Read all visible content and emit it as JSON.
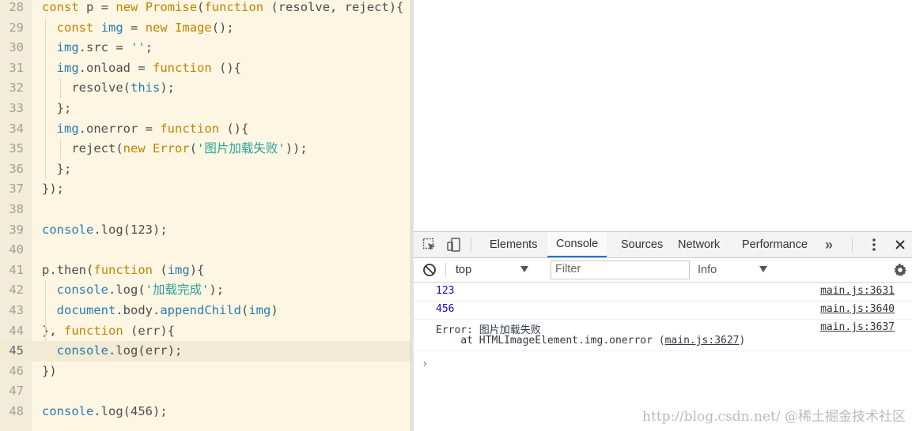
{
  "editor": {
    "active_line": "45",
    "lines": [
      {
        "n": "28",
        "text": "const p = new Promise(function (resolve, reject){"
      },
      {
        "n": "29",
        "text": "  const img = new Image();"
      },
      {
        "n": "30",
        "text": "  img.src = '';"
      },
      {
        "n": "31",
        "text": "  img.onload = function (){"
      },
      {
        "n": "32",
        "text": "    resolve(this);"
      },
      {
        "n": "33",
        "text": "  };"
      },
      {
        "n": "34",
        "text": "  img.onerror = function (){"
      },
      {
        "n": "35",
        "text": "    reject(new Error('图片加载失败'));"
      },
      {
        "n": "36",
        "text": "  };"
      },
      {
        "n": "37",
        "text": "});"
      },
      {
        "n": "38",
        "text": ""
      },
      {
        "n": "39",
        "text": "console.log(123);"
      },
      {
        "n": "40",
        "text": ""
      },
      {
        "n": "41",
        "text": "p.then(function (img){"
      },
      {
        "n": "42",
        "text": "  console.log('加载完成');"
      },
      {
        "n": "43",
        "text": "  document.body.appendChild(img)"
      },
      {
        "n": "44",
        "text": "}, function (err){"
      },
      {
        "n": "45",
        "text": "  console.log(err);"
      },
      {
        "n": "46",
        "text": "})"
      },
      {
        "n": "47",
        "text": ""
      },
      {
        "n": "48",
        "text": "console.log(456);"
      }
    ]
  },
  "devtools": {
    "tabs": [
      {
        "label": "Elements"
      },
      {
        "label": "Console",
        "selected": true
      },
      {
        "label": "Sources"
      },
      {
        "label": "Network"
      },
      {
        "label": "Performance"
      }
    ],
    "more_tabs_glyph": "»",
    "icons": {
      "inspect": "inspect-element-icon",
      "device": "device-toolbar-icon",
      "more": "kebab-menu-icon",
      "close": "close-icon",
      "clear": "clear-console-icon",
      "settings": "gear-icon"
    },
    "console_toolbar": {
      "context": "top",
      "filter_placeholder": "Filter",
      "level": "Info"
    },
    "messages": [
      {
        "text": "123",
        "source": "main.js:3631"
      },
      {
        "text": "456",
        "source": "main.js:3640"
      },
      {
        "text": "Error: 图片加载失败",
        "stack_prefix": "    at HTMLImageElement.img.onerror (",
        "stack_link": "main.js:3627",
        "stack_suffix": ")",
        "source": "main.js:3637"
      }
    ],
    "prompt": "›"
  },
  "watermark": "http://blog.csdn.net/  @稀土掘金技术社区",
  "colors": {
    "editor_bg": "#fdf6e3",
    "keyword": "#c18401",
    "identifier": "#2a7ab0",
    "string": "#2aa198",
    "plain": "#4d4d4c",
    "console_number": "#1c00cf",
    "tab_underline": "#1a73e8"
  }
}
